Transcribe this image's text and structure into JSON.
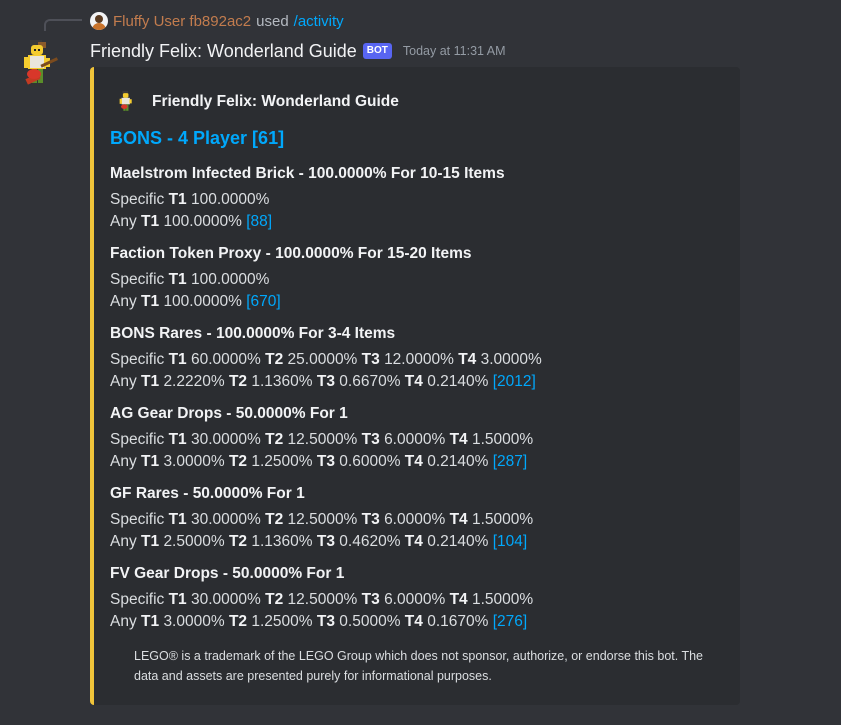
{
  "reply": {
    "user": "Fluffy User fb892ac2",
    "used": "used",
    "command": "/activity"
  },
  "message": {
    "author": "Friendly Felix: Wonderland Guide",
    "bot_tag": "BOT",
    "timestamp": "Today at 11:31 AM"
  },
  "embed": {
    "accent_color": "#f0c43a",
    "author_name": "Friendly Felix: Wonderland Guide",
    "title": "BONS - 4 Player [61]",
    "fields": [
      {
        "name": "Maelstrom Infected Brick - 100.0000% For 10-15 Items",
        "specific": {
          "label": "Specific",
          "tiers": [
            {
              "t": "T1",
              "v": "100.0000%"
            }
          ]
        },
        "any": {
          "label": "Any",
          "tiers": [
            {
              "t": "T1",
              "v": "100.0000%"
            }
          ],
          "link": "[88]"
        }
      },
      {
        "name": "Faction Token Proxy - 100.0000% For 15-20 Items",
        "specific": {
          "label": "Specific",
          "tiers": [
            {
              "t": "T1",
              "v": "100.0000%"
            }
          ]
        },
        "any": {
          "label": "Any",
          "tiers": [
            {
              "t": "T1",
              "v": "100.0000%"
            }
          ],
          "link": "[670]"
        }
      },
      {
        "name": "BONS Rares - 100.0000% For 3-4 Items",
        "specific": {
          "label": "Specific",
          "tiers": [
            {
              "t": "T1",
              "v": "60.0000%"
            },
            {
              "t": "T2",
              "v": "25.0000%"
            },
            {
              "t": "T3",
              "v": "12.0000%"
            },
            {
              "t": "T4",
              "v": "3.0000%"
            }
          ]
        },
        "any": {
          "label": "Any",
          "tiers": [
            {
              "t": "T1",
              "v": "2.2220%"
            },
            {
              "t": "T2",
              "v": "1.1360%"
            },
            {
              "t": "T3",
              "v": "0.6670%"
            },
            {
              "t": "T4",
              "v": "0.2140%"
            }
          ],
          "link": "[2012]"
        }
      },
      {
        "name": "AG Gear Drops - 50.0000% For 1",
        "specific": {
          "label": "Specific",
          "tiers": [
            {
              "t": "T1",
              "v": "30.0000%"
            },
            {
              "t": "T2",
              "v": "12.5000%"
            },
            {
              "t": "T3",
              "v": "6.0000%"
            },
            {
              "t": "T4",
              "v": "1.5000%"
            }
          ]
        },
        "any": {
          "label": "Any",
          "tiers": [
            {
              "t": "T1",
              "v": "3.0000%"
            },
            {
              "t": "T2",
              "v": "1.2500%"
            },
            {
              "t": "T3",
              "v": "0.6000%"
            },
            {
              "t": "T4",
              "v": "0.2140%"
            }
          ],
          "link": "[287]"
        }
      },
      {
        "name": "GF Rares - 50.0000% For 1",
        "specific": {
          "label": "Specific",
          "tiers": [
            {
              "t": "T1",
              "v": "30.0000%"
            },
            {
              "t": "T2",
              "v": "12.5000%"
            },
            {
              "t": "T3",
              "v": "6.0000%"
            },
            {
              "t": "T4",
              "v": "1.5000%"
            }
          ]
        },
        "any": {
          "label": "Any",
          "tiers": [
            {
              "t": "T1",
              "v": "2.5000%"
            },
            {
              "t": "T2",
              "v": "1.1360%"
            },
            {
              "t": "T3",
              "v": "0.4620%"
            },
            {
              "t": "T4",
              "v": "0.2140%"
            }
          ],
          "link": "[104]"
        }
      },
      {
        "name": "FV Gear Drops - 50.0000% For 1",
        "specific": {
          "label": "Specific",
          "tiers": [
            {
              "t": "T1",
              "v": "30.0000%"
            },
            {
              "t": "T2",
              "v": "12.5000%"
            },
            {
              "t": "T3",
              "v": "6.0000%"
            },
            {
              "t": "T4",
              "v": "1.5000%"
            }
          ]
        },
        "any": {
          "label": "Any",
          "tiers": [
            {
              "t": "T1",
              "v": "3.0000%"
            },
            {
              "t": "T2",
              "v": "1.2500%"
            },
            {
              "t": "T3",
              "v": "0.5000%"
            },
            {
              "t": "T4",
              "v": "0.1670%"
            }
          ],
          "link": "[276]"
        }
      }
    ],
    "footer": "LEGO® is a trademark of the LEGO Group which does not sponsor, authorize, or endorse this bot. The data and assets are presented purely for informational purposes."
  },
  "icons": {
    "bot_avatar": "lego-minifig-guitar-icon",
    "user_avatar": "user-avatar-icon"
  }
}
